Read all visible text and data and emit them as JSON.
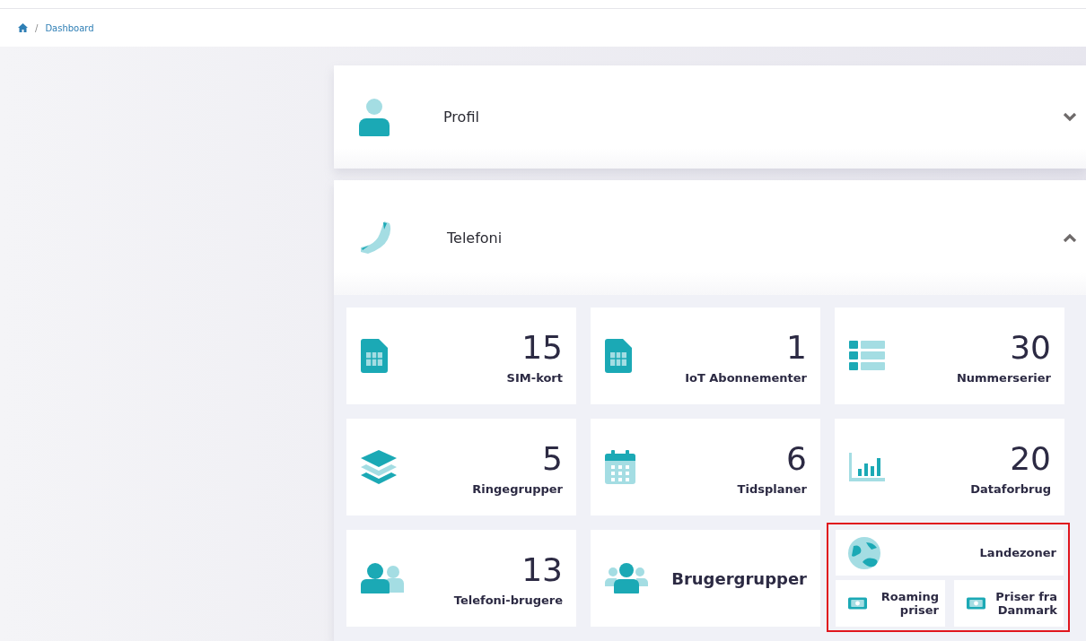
{
  "breadcrumb": {
    "separator": "/",
    "items": [
      "Dashboard"
    ]
  },
  "panels": [
    {
      "title": "Profil",
      "kind": "person",
      "expanded": false
    },
    {
      "title": "Telefoni",
      "kind": "phone",
      "expanded": true,
      "tiles": [
        {
          "kind": "sim",
          "value": "15",
          "label": "SIM-kort"
        },
        {
          "kind": "sim",
          "value": "1",
          "label": "IoT Abonnementer"
        },
        {
          "kind": "list",
          "value": "30",
          "label": "Nummerserier"
        },
        {
          "kind": "layers",
          "value": "5",
          "label": "Ringegrupper"
        },
        {
          "kind": "calendar",
          "value": "6",
          "label": "Tidsplaner"
        },
        {
          "kind": "chart",
          "value": "20",
          "label": "Dataforbrug"
        },
        {
          "kind": "users",
          "value": "13",
          "label": "Telefoni-brugere"
        },
        {
          "kind": "group",
          "label": "Brugergrupper"
        },
        {
          "kind": "cluster",
          "highlighted": true,
          "main": {
            "kind": "globe",
            "label": "Landezoner"
          },
          "subs": [
            {
              "kind": "money",
              "label": "Roaming priser"
            },
            {
              "kind": "money",
              "label": "Priser fra Danmark"
            }
          ]
        }
      ]
    }
  ]
}
